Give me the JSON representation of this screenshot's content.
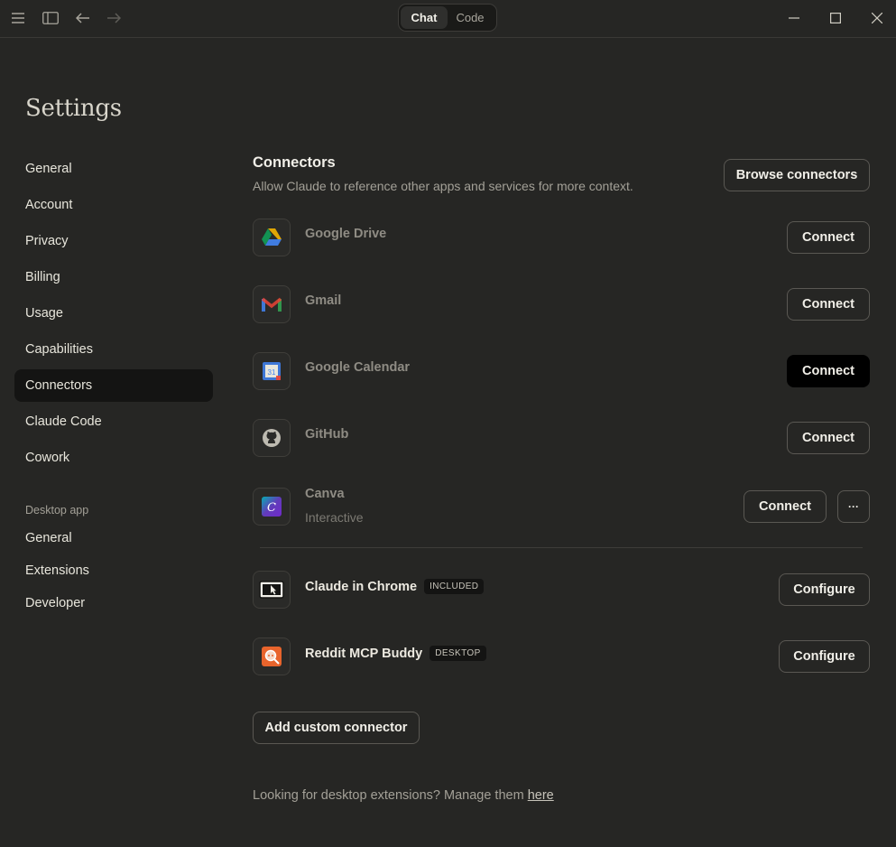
{
  "titlebar": {
    "icons": [
      "menu-icon",
      "sidebar-toggle-icon",
      "back-arrow-icon",
      "forward-arrow-icon"
    ],
    "toggle": {
      "active": "Chat",
      "inactive": "Code"
    },
    "window_controls": [
      "minimize-icon",
      "maximize-icon",
      "close-icon"
    ]
  },
  "sidebar": {
    "title": "Settings",
    "items": [
      {
        "label": "General"
      },
      {
        "label": "Account"
      },
      {
        "label": "Privacy"
      },
      {
        "label": "Billing"
      },
      {
        "label": "Usage"
      },
      {
        "label": "Capabilities"
      },
      {
        "label": "Connectors",
        "selected": true
      },
      {
        "label": "Claude Code"
      },
      {
        "label": "Cowork"
      }
    ],
    "desktop_section": "Desktop app",
    "desktop_items": [
      {
        "label": "General"
      },
      {
        "label": "Extensions"
      },
      {
        "label": "Developer"
      }
    ]
  },
  "main": {
    "title": "Connectors",
    "subtitle": "Allow Claude to reference other apps and services for more context.",
    "browse_label": "Browse connectors",
    "connectors": [
      {
        "name": "Google Drive",
        "action": "Connect",
        "icon": "google-drive-icon"
      },
      {
        "name": "Gmail",
        "action": "Connect",
        "icon": "gmail-icon"
      },
      {
        "name": "Google Calendar",
        "action": "Connect",
        "icon": "google-calendar-icon"
      },
      {
        "name": "GitHub",
        "action": "Connect",
        "icon": "github-icon"
      },
      {
        "name": "Canva",
        "sub": "Interactive",
        "action": "Connect",
        "more": "···",
        "icon": "canva-icon"
      }
    ],
    "installed": [
      {
        "name": "Claude in Chrome",
        "badge": "INCLUDED",
        "action": "Configure",
        "icon": "chrome-cursor-icon"
      },
      {
        "name": "Reddit MCP Buddy",
        "badge": "DESKTOP",
        "action": "Configure",
        "icon": "reddit-search-icon"
      }
    ],
    "add_custom_label": "Add custom connector",
    "footer_text": "Looking for desktop extensions? Manage them ",
    "footer_link": "here"
  }
}
